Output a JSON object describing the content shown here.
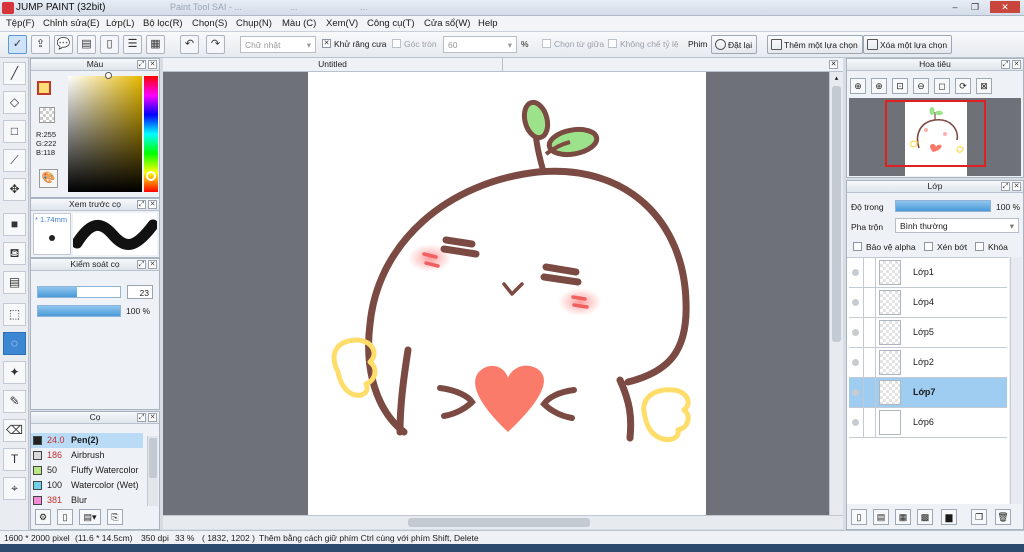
{
  "window": {
    "title": "JUMP PAINT (32bit)",
    "ghost_tabs": [
      "Paint Tool SAI - ...",
      "...",
      "..."
    ]
  },
  "menu": [
    "Tệp(F)",
    "Chỉnh sửa(E)",
    "Lớp(L)",
    "Bộ lọc(R)",
    "Chọn(S)",
    "Chụp(N)",
    "Màu (C)",
    "Xem(V)",
    "Công cụ(T)",
    "Cửa sổ(W)",
    "Help"
  ],
  "toolbar": {
    "shape_select": "Chữ nhật",
    "antialias_label": "Khử răng cưa",
    "antialias_checked": "✕",
    "round_corner_label": "Góc tròn",
    "round_corner_value": "60",
    "percent": "%",
    "from_center_label": "Chọn từ giữa",
    "no_ratio_label": "Không chế tỷ lệ",
    "film_label": "Phim",
    "reset_label": "Đặt lại",
    "add_selection_label": "Thêm một lựa chọn",
    "remove_selection_label": "Xóa một lựa chọn"
  },
  "color_panel": {
    "title": "Màu",
    "r": "R:255",
    "g": "G:222",
    "b": "B:118",
    "fg_color": "#ffde76"
  },
  "preview_panel": {
    "title": "Xem trước cọ",
    "size": "* 1.74mm"
  },
  "control_panel": {
    "title": "Kiểm soát cọ",
    "size_value": "23",
    "opacity_value": "100 %"
  },
  "brush_panel": {
    "title": "Cọ",
    "items": [
      {
        "size": "24.0",
        "name": "Pen(2)",
        "color": "#222222",
        "selected": true
      },
      {
        "size": "186",
        "name": "Airbrush",
        "color": "#d9d9d9",
        "selected": false
      },
      {
        "size": "50",
        "name": "Fluffy Watercolor",
        "color": "#b8e986",
        "selected": false
      },
      {
        "size": "100",
        "name": "Watercolor (Wet)",
        "color": "#6fd2ea",
        "selected": false
      },
      {
        "size": "381",
        "name": "Blur",
        "color": "#f38bd8",
        "selected": false
      }
    ]
  },
  "canvas": {
    "tab_title": "Untitled"
  },
  "navigator": {
    "title": "Hoa tiêu"
  },
  "layers_panel": {
    "title": "Lớp",
    "opacity_label": "Độ trong",
    "opacity_value": "100 %",
    "blend_label": "Pha trộn",
    "blend_value": "Bình thường",
    "protect_alpha": "Bảo vệ alpha",
    "clip_label": "Xén bớt",
    "lock_label": "Khóa",
    "layers": [
      {
        "name": "Lớp1",
        "selected": false
      },
      {
        "name": "Lớp4",
        "selected": false
      },
      {
        "name": "Lớp5",
        "selected": false
      },
      {
        "name": "Lớp2",
        "selected": false
      },
      {
        "name": "Lớp7",
        "selected": true
      },
      {
        "name": "Lớp6",
        "selected": false
      }
    ]
  },
  "status": {
    "dimensions": "1600 * 2000 pixel",
    "physical": "(11.6 * 14.5cm)",
    "dpi": "350 dpi",
    "zoom": "33 %",
    "coords": "( 1832, 1202 )",
    "hint": "Thêm bằng cách giữ phím Ctrl cùng với phím Shift, Delete"
  }
}
